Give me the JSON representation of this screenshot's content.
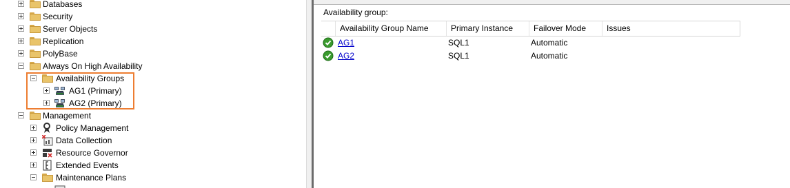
{
  "tree": {
    "items": [
      {
        "label": "Databases",
        "icon": "folder-icon",
        "expander": "plus"
      },
      {
        "label": "Security",
        "icon": "folder-icon",
        "expander": "plus"
      },
      {
        "label": "Server Objects",
        "icon": "folder-icon",
        "expander": "plus"
      },
      {
        "label": "Replication",
        "icon": "folder-icon",
        "expander": "plus"
      },
      {
        "label": "PolyBase",
        "icon": "folder-icon",
        "expander": "plus"
      },
      {
        "label": "Always On High Availability",
        "icon": "folder-icon",
        "expander": "minus"
      },
      {
        "label": "Availability Groups",
        "icon": "folder-icon",
        "expander": "minus"
      },
      {
        "label": "AG1 (Primary)",
        "icon": "availability-group-icon",
        "expander": "plus"
      },
      {
        "label": "AG2 (Primary)",
        "icon": "availability-group-icon",
        "expander": "plus"
      },
      {
        "label": "Management",
        "icon": "folder-icon",
        "expander": "minus"
      },
      {
        "label": "Policy Management",
        "icon": "policy-management-icon",
        "expander": "plus"
      },
      {
        "label": "Data Collection",
        "icon": "data-collection-icon",
        "expander": "plus"
      },
      {
        "label": "Resource Governor",
        "icon": "resource-governor-icon",
        "expander": "plus"
      },
      {
        "label": "Extended Events",
        "icon": "extended-events-icon",
        "expander": "plus"
      },
      {
        "label": "Maintenance Plans",
        "icon": "folder-icon",
        "expander": "minus"
      }
    ],
    "highlight_color": "#ed7d31"
  },
  "details": {
    "section_title": "Availability group:",
    "columns": [
      "Availability Group Name",
      "Primary Instance",
      "Failover Mode",
      "Issues"
    ],
    "rows": [
      {
        "name": "AG1",
        "primary_instance": "SQL1",
        "failover_mode": "Automatic",
        "issues": "",
        "status_icon": "healthy-check-icon"
      },
      {
        "name": "AG2",
        "primary_instance": "SQL1",
        "failover_mode": "Automatic",
        "issues": "",
        "status_icon": "healthy-check-icon"
      }
    ]
  },
  "colors": {
    "link": "#0000cc",
    "folder": "#e9c46a",
    "ok": "#3a9b2e"
  }
}
